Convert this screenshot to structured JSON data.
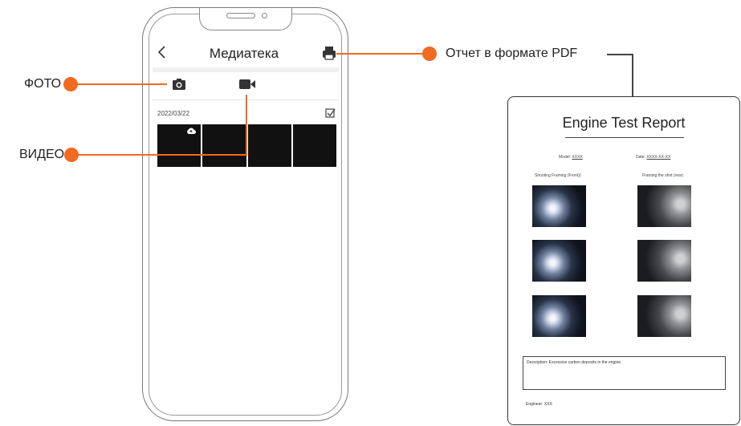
{
  "phone": {
    "header": {
      "title": "Медиатека",
      "back_icon": "chevron-left-icon",
      "pdf_icon": "printer-icon"
    },
    "tabs": [
      {
        "icon": "camera-icon"
      },
      {
        "icon": "video-camera-icon"
      }
    ],
    "date": "2022/03/22",
    "select_icon": "checkbox-icon",
    "thumbnails": [
      {
        "type": "photo",
        "badge": "cloud-upload-icon"
      },
      {
        "type": "photo"
      },
      {
        "type": "photo"
      },
      {
        "type": "photo"
      }
    ]
  },
  "callouts": {
    "photo": "ФОТО",
    "video": "ВИДЕО",
    "pdf": "Отчет в формате PDF",
    "color": "#f06b1f"
  },
  "report": {
    "title": "Engine Test Report",
    "model_label": "Model:",
    "model_value": "XXXX",
    "date_label": "Date:",
    "date_value": "XXXX-XX-XX",
    "col_left": "Shooting Framing (Front))",
    "col_right": "Framing the shot (rear)",
    "description": "Description: Excessive carbon deposits in the engine.",
    "engineer": "Engineer: XXX"
  }
}
